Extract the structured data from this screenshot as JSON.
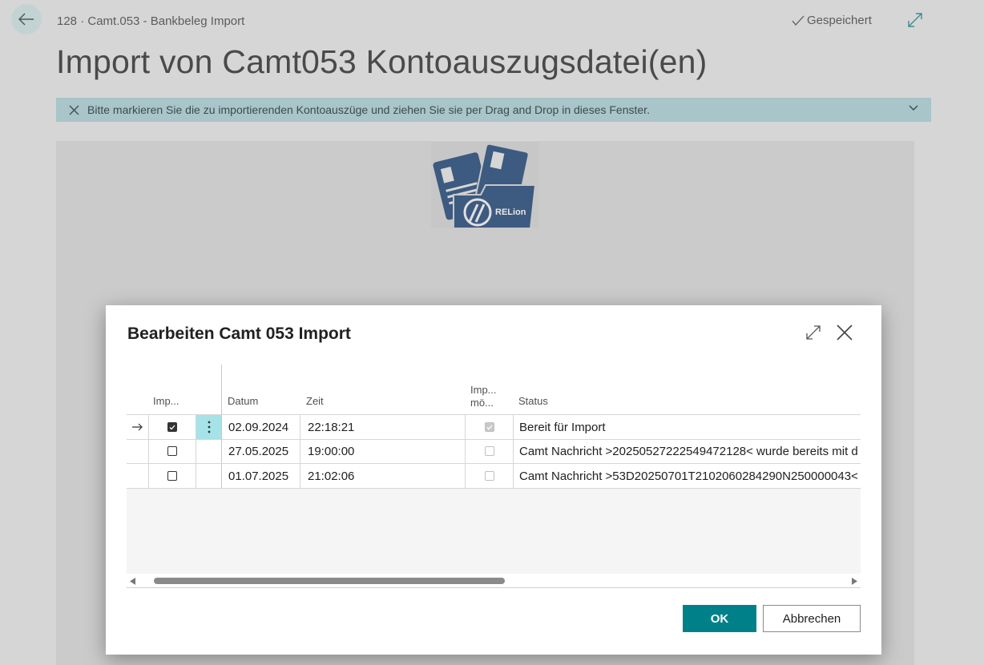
{
  "header": {
    "breadcrumb": "128 · Camt.053 - Bankbeleg Import",
    "saved_status": "Gespeichert",
    "page_title": "Import von Camt053 Kontoauszugsdatei(en)"
  },
  "banner": {
    "message": "Bitte markieren Sie die zu importierenden Kontoauszüge und ziehen Sie sie per Drag and Drop in dieses Fenster."
  },
  "logo": {
    "text": "RELion"
  },
  "dialog": {
    "title": "Bearbeiten Camt 053 Import",
    "columns": {
      "import": "Imp...",
      "datum": "Datum",
      "zeit": "Zeit",
      "import_possible_line1": "Imp...",
      "import_possible_line2": "mö...",
      "status": "Status"
    },
    "rows": [
      {
        "selected": true,
        "import": true,
        "datum": "02.09.2024",
        "zeit": "22:18:21",
        "import_possible": true,
        "status": "Bereit für Import"
      },
      {
        "selected": false,
        "import": false,
        "datum": "27.05.2025",
        "zeit": "19:00:00",
        "import_possible": false,
        "status": "Camt Nachricht >20250527222549472128< wurde bereits mit d"
      },
      {
        "selected": false,
        "import": false,
        "datum": "01.07.2025",
        "zeit": "21:02:06",
        "import_possible": false,
        "status": "Camt Nachricht >53D20250701T2102060284290N250000043<"
      }
    ],
    "ok_label": "OK",
    "cancel_label": "Abbrechen"
  },
  "colors": {
    "accent": "#00818a",
    "banner": "#a8c5c9",
    "back_button": "#c3d3d3",
    "logo_blue": "#3d5a80"
  },
  "icons": [
    "back-arrow-icon",
    "checkmark-icon",
    "expand-icon",
    "close-icon",
    "chevron-down-icon",
    "row-arrow-icon",
    "more-vertical-icon",
    "scroll-left-icon",
    "scroll-right-icon"
  ]
}
